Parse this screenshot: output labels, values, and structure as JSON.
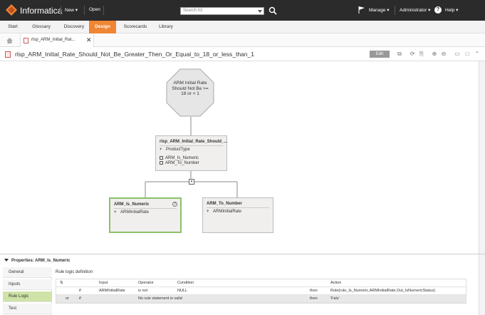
{
  "app": {
    "brand": "Informatica",
    "new_label": "New",
    "open_label": "Open",
    "search_placeholder": "Search All",
    "manage_label": "Manage",
    "admin_label": "Administrator",
    "help_label": "Help",
    "brand_color": "#f08533"
  },
  "nav_tabs": [
    {
      "label": "Start"
    },
    {
      "label": "Glossary"
    },
    {
      "label": "Discovery"
    },
    {
      "label": "Design",
      "active": true
    },
    {
      "label": "Scorecards"
    },
    {
      "label": "Library"
    }
  ],
  "object_tab": {
    "label": "rlsp_ARM_Initial_Rat..."
  },
  "title": {
    "text": "rlsp_ARM_Initial_Rate_Should_Not_Be_Greater_Then_Or_Equal_to_18_or_less_than_1",
    "edit_label": "Edit"
  },
  "canvas": {
    "octagon_text": "ARM Initial Rate Should Not Be >= 18 or < 1",
    "main_node": {
      "title": "rlsp_ARM_Initial_Rate_Should_...",
      "input": "ProductType",
      "rules": [
        "ARM_Is_Numeric",
        "ARM_To_Number"
      ]
    },
    "child_nodes": [
      {
        "title": "ARM_Is_Numeric",
        "input": "ARMInitialRate",
        "selected": true
      },
      {
        "title": "ARM_To_Number",
        "input": "ARMInitialRate",
        "selected": false
      }
    ]
  },
  "properties": {
    "header": "Properties: ARM_Is_Numeric",
    "side_items": [
      {
        "label": "General"
      },
      {
        "label": "Inputs"
      },
      {
        "label": "Rule Logic",
        "active": true
      },
      {
        "label": "Test"
      }
    ],
    "rule_logic_label": "Rule logic definition",
    "columns": {
      "input": "Input",
      "operator": "Operator",
      "condition": "Condition",
      "action": "Action"
    },
    "rows": [
      {
        "prefix": "",
        "if": "if",
        "input": "ARMInitialRate",
        "operator": "is not",
        "condition": "NULL",
        "then": "then",
        "action": "Rule(rule_Is_Numeric,ARMInitialRate,Out_IsNumericStatus)"
      },
      {
        "prefix": "or",
        "if": "if",
        "input": "",
        "operator": "No rule statement is valid",
        "condition": "",
        "then": "then",
        "action": "'Fals'"
      }
    ]
  }
}
